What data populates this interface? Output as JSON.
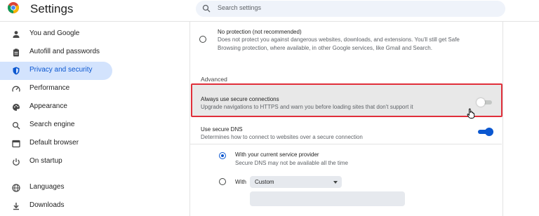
{
  "app": {
    "title": "Settings"
  },
  "search": {
    "placeholder": "Search settings"
  },
  "sidebar": {
    "items": [
      {
        "label": "You and Google",
        "icon": "person-icon"
      },
      {
        "label": "Autofill and passwords",
        "icon": "clipboard-icon"
      },
      {
        "label": "Privacy and security",
        "icon": "shield-icon",
        "active": true
      },
      {
        "label": "Performance",
        "icon": "speedometer-icon"
      },
      {
        "label": "Appearance",
        "icon": "palette-icon"
      },
      {
        "label": "Search engine",
        "icon": "search-icon"
      },
      {
        "label": "Default browser",
        "icon": "browser-window-icon"
      },
      {
        "label": "On startup",
        "icon": "power-icon"
      },
      {
        "label": "Languages",
        "icon": "globe-icon"
      },
      {
        "label": "Downloads",
        "icon": "download-icon"
      }
    ]
  },
  "main": {
    "no_protection": {
      "title": "No protection (not recommended)",
      "desc_line1": "Does not protect you against dangerous websites, downloads, and extensions. You'll still get Safe",
      "desc_line2": "Browsing protection, where available, in other Google services, like Gmail and Search.",
      "selected": false
    },
    "advanced_heading": "Advanced",
    "secure_connections": {
      "title": "Always use secure connections",
      "desc": "Upgrade navigations to HTTPS and warn you before loading sites that don't support it",
      "enabled": false
    },
    "secure_dns": {
      "title": "Use secure DNS",
      "desc": "Determines how to connect to websites over a secure connection",
      "enabled": true,
      "option_current": {
        "title": "With your current service provider",
        "desc": "Secure DNS may not be available all the time",
        "selected": true
      },
      "option_with": {
        "label": "With",
        "select_value": "Custom",
        "selected": false
      }
    }
  },
  "colors": {
    "accent": "#0b57d0",
    "active_nav_bg": "#d3e3fd",
    "highlight_border": "#e02f3a"
  }
}
